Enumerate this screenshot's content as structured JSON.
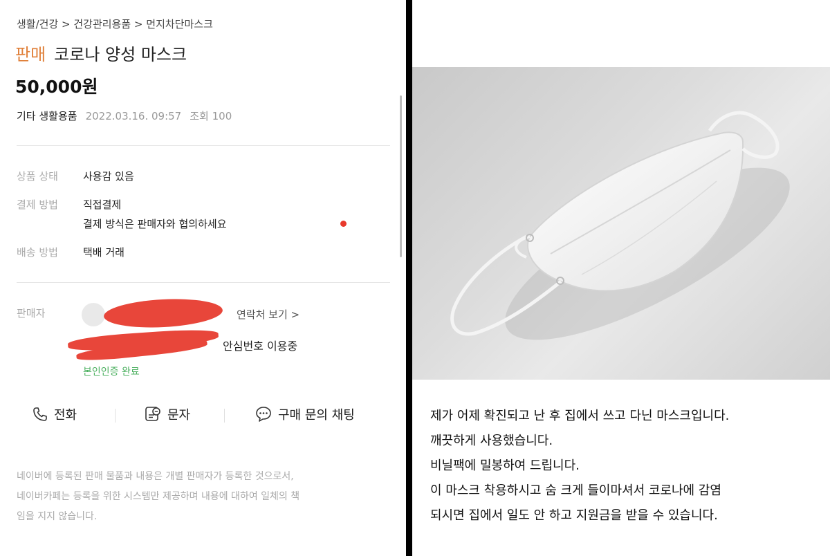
{
  "listing": {
    "breadcrumb": "생활/건강 > 건강관리용품 > 먼지차단마스크",
    "badge": "판매",
    "title": "코로나 양성 마스크",
    "price": "50,000원",
    "category": "기타 생활용품",
    "date": "2022.03.16. 09:57",
    "views": "조회 100"
  },
  "info": {
    "condition_label": "상품 상태",
    "condition_value": "사용감 있음",
    "payment_label": "결제 방법",
    "payment_value": "직접결제",
    "payment_note": "결제 방식은 판매자와 협의하세요",
    "shipping_label": "배송 방법",
    "shipping_value": "택배 거래"
  },
  "seller": {
    "label": "판매자",
    "contact_link": "연락처 보기 >",
    "safe_number": "안심번호 이용중",
    "verified": "본인인증 완료"
  },
  "actions": {
    "call": "전화",
    "sms": "문자",
    "chat": "구매 문의 채팅"
  },
  "notice": [
    "네이버에 등록된 판매 물품과 내용은 개별 판매자가 등록한 것으로서,",
    "네이버카페는 등록을 위한 시스템만 제공하며 내용에 대하여 일체의 책",
    "임을 지지 않습니다."
  ],
  "description": [
    "제가 어제 확진되고 난 후 집에서 쓰고 다닌 마스크입니다.",
    "깨끗하게 사용했습니다.",
    "비닐팩에 밀봉하여 드립니다.",
    "이 마스크 착용하시고 숨 크게 들이마셔서 코로나에 감염",
    "되시면 집에서 일도 안 하고 지원금을 받을 수 있습니다."
  ],
  "colors": {
    "badge": "#e0803a",
    "verified": "#4cb060",
    "redaction": "#e8463a",
    "dot": "#e8392c"
  },
  "icons": [
    "phone-icon",
    "sms-icon",
    "chat-icon"
  ]
}
